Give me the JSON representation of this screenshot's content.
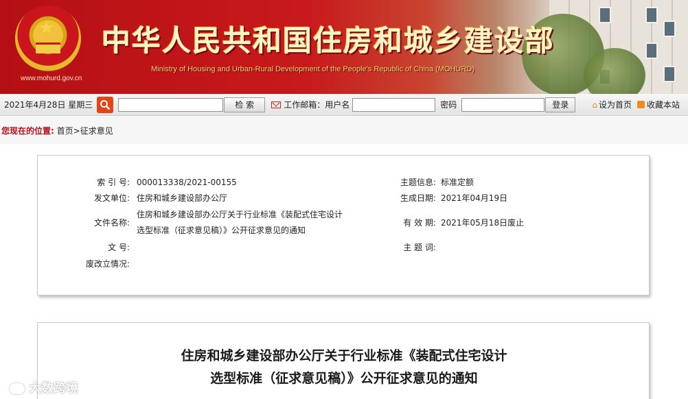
{
  "header": {
    "site_url": "www.mohurd.gov.cn",
    "title_cn": "中华人民共和国住房和城乡建设部",
    "title_en": "Ministry of Housing and Urban-Rural Development of the People's Republic of China (MOHURD)",
    "emblem_icon": "national-emblem"
  },
  "toolbar": {
    "date": "2021年4月28日 星期三",
    "search_icon": "search-icon",
    "search_value": "",
    "search_button": "检  索",
    "mail_label": "工作邮箱：",
    "username_label": "用户名",
    "username_value": "",
    "password_label": "密码",
    "password_value": "",
    "login_button": "登录",
    "set_home": "设为首页",
    "bookmark": "收藏本站"
  },
  "breadcrumb": {
    "label": "您现在的位置:",
    "home": "首页",
    "sep": ">",
    "current": "征求意见"
  },
  "meta": {
    "index_label": "索 引 号:",
    "index_value": "000013338/2021-00155",
    "topic_label": "主题信息:",
    "topic_value": "标准定额",
    "issuer_label": "发文单位:",
    "issuer_value": "住房和城乡建设部办公厅",
    "created_label": "生成日期:",
    "created_value": "2021年04月19日",
    "filename_label": "文件名称:",
    "filename_line1": "住房和城乡建设部办公厅关于行业标准《装配式住宅设计",
    "filename_line2": "选型标准（征求意见稿）》公开征求意见的通知",
    "validity_label": "有 效 期:",
    "validity_value": "2021年05月18日废止",
    "docno_label": "文        号:",
    "docno_value": "",
    "keywords_label": "主 题 词:",
    "keywords_value": "",
    "status_label": "废改立情况:",
    "status_value": ""
  },
  "document": {
    "title_line1": "住房和城乡建设部办公厅关于行业标准《装配式住宅设计",
    "title_line2": "选型标准（征求意见稿）》公开征求意见的通知"
  },
  "watermark": "大数跨境",
  "colors": {
    "banner_red": "#c81a1c",
    "breadcrumb_label": "#b3141a",
    "search_button_bg": "#e24418"
  }
}
